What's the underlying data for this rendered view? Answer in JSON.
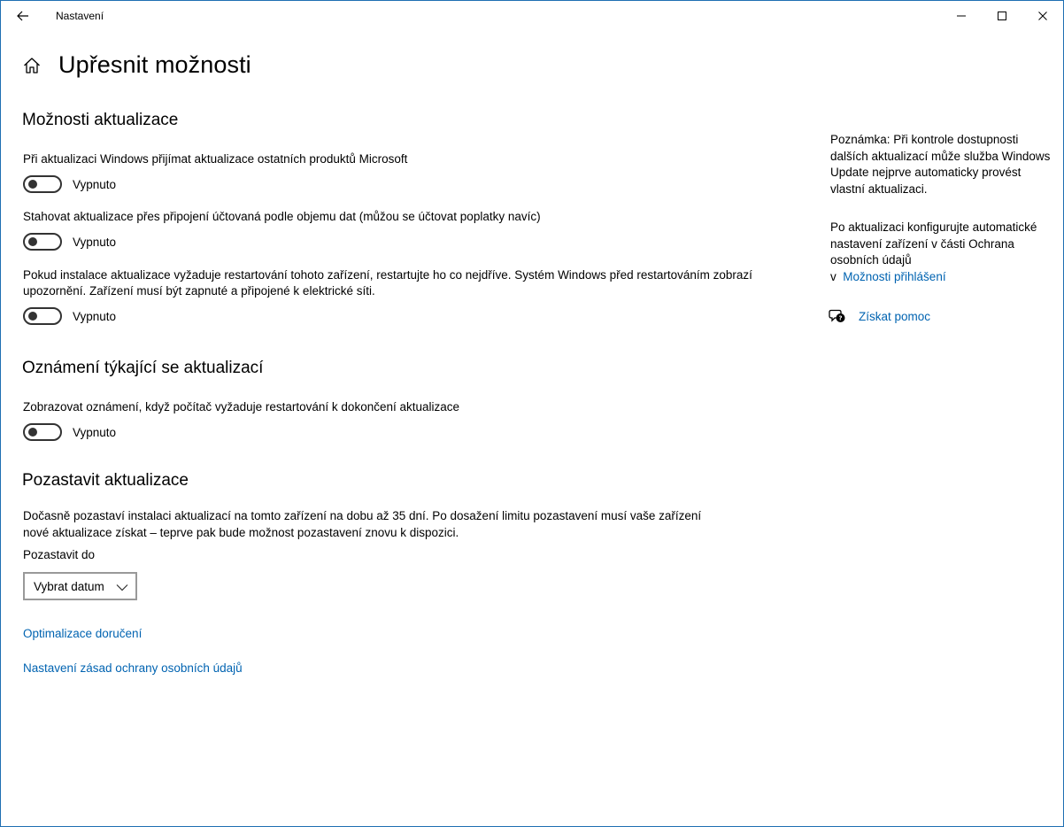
{
  "window": {
    "title": "Nastavení"
  },
  "header": {
    "title": "Upřesnit možnosti"
  },
  "sections": {
    "update_options": {
      "title": "Možnosti aktualizace",
      "options": [
        {
          "label": "Při aktualizaci Windows přijímat aktualizace ostatních produktů Microsoft",
          "state": "Vypnuto",
          "on": false
        },
        {
          "label": "Stahovat aktualizace přes připojení účtovaná podle objemu dat (můžou se účtovat poplatky navíc)",
          "state": "Vypnuto",
          "on": false
        },
        {
          "label": "Pokud instalace aktualizace vyžaduje restartování tohoto zařízení, restartujte ho co nejdříve. Systém Windows před restartováním zobrazí upozornění. Zařízení musí být zapnuté a připojené k elektrické síti.",
          "state": "Vypnuto",
          "on": false
        }
      ]
    },
    "notifications": {
      "title": "Oznámení týkající se aktualizací",
      "options": [
        {
          "label": "Zobrazovat oznámení, když počítač vyžaduje restartování k dokončení aktualizace",
          "state": "Vypnuto",
          "on": false
        }
      ]
    },
    "pause": {
      "title": "Pozastavit aktualizace",
      "description": "Dočasně pozastaví instalaci aktualizací na tomto zařízení na dobu až 35 dní. Po dosažení limitu pozastavení musí vaše zařízení nové aktualizace získat – teprve pak bude možnost pozastavení znovu k dispozici.",
      "field_label": "Pozastavit do",
      "select_value": "Vybrat datum"
    }
  },
  "links": {
    "delivery_optimization": "Optimalizace doručení",
    "privacy_settings": "Nastavení zásad ochrany osobních údajů"
  },
  "sidebar": {
    "note": "Poznámka: Při kontrole dostupnosti dalších aktualizací může služba Windows Update nejprve automaticky provést vlastní aktualizaci.",
    "config_text": "Po aktualizaci konfigurujte automatické nastavení zařízení v části Ochrana osobních údajů",
    "config_prefix": "v",
    "config_link": "Možnosti přihlášení",
    "help_link": "Získat pomoc"
  },
  "icons": {
    "back": "back-arrow-icon",
    "home": "home-icon",
    "help": "chat-help-icon",
    "chevron": "chevron-down-icon"
  },
  "colors": {
    "link": "#0063b1",
    "window_border": "#1f6fb2"
  }
}
